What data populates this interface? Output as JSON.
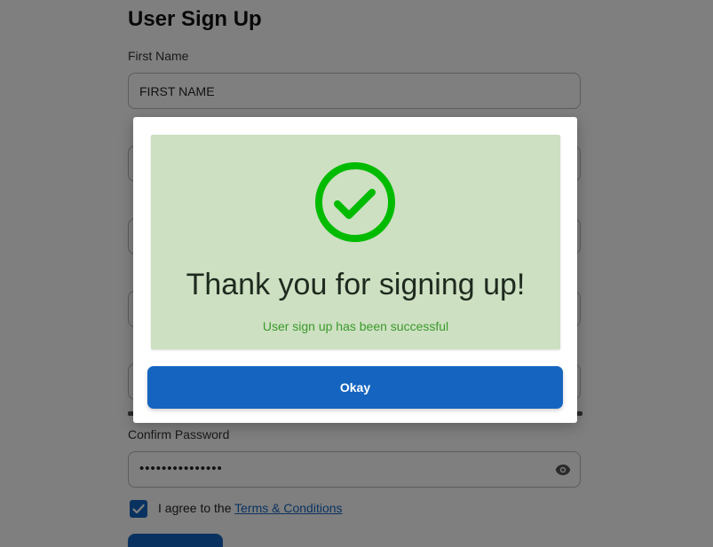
{
  "form": {
    "title": "User Sign Up",
    "first_name_label": "First Name",
    "first_name_placeholder": "FIRST NAME",
    "confirm_password_label": "Confirm Password",
    "confirm_password_value": "•••••••••••••••",
    "agree_prefix": "I agree to the ",
    "agree_link": "Terms & Conditions",
    "agree_checked": true,
    "password_strength": 1.0
  },
  "modal": {
    "icon": "check-circle-icon",
    "title": "Thank you for signing up!",
    "subtitle": "User sign up has been successful",
    "okay_label": "Okay",
    "success_color": "#00bb00",
    "panel_color": "#cde0c2",
    "button_color": "#1565c0"
  }
}
